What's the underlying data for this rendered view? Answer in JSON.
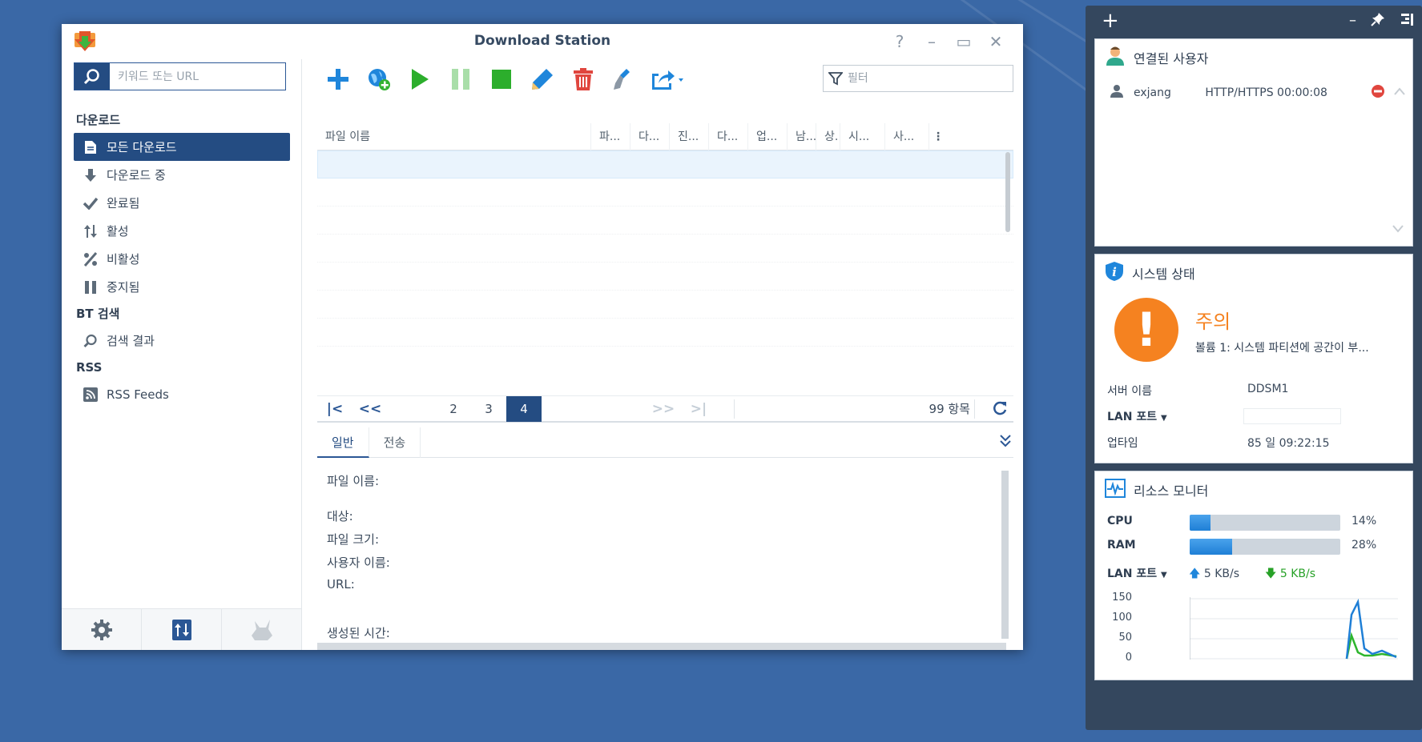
{
  "window": {
    "title": "Download Station",
    "controls": [
      "help-icon",
      "minimize-icon",
      "maximize-icon",
      "close-icon"
    ]
  },
  "search": {
    "placeholder": "키워드 또는 URL",
    "value": ""
  },
  "sidebar": {
    "download_section": "다운로드",
    "items": [
      {
        "label": "모든 다운로드",
        "icon": "document-icon",
        "selected": true
      },
      {
        "label": "다운로드 중",
        "icon": "arrow-down-icon"
      },
      {
        "label": "완료됨",
        "icon": "checkmark-icon"
      },
      {
        "label": "활성",
        "icon": "up-down-arrows-icon"
      },
      {
        "label": "비활성",
        "icon": "percent-icon"
      },
      {
        "label": "중지됨",
        "icon": "pause-icon"
      }
    ],
    "bt_section": "BT 검색",
    "bt_items": [
      {
        "label": "검색 결과",
        "icon": "magnifier-icon"
      }
    ],
    "rss_section": "RSS",
    "rss_items": [
      {
        "label": "RSS Feeds",
        "icon": "rss-icon"
      }
    ],
    "footer_buttons": [
      "settings-icon",
      "transfer-icon",
      "mascot-icon"
    ]
  },
  "toolbar": {
    "buttons": [
      "add-icon",
      "add-url-icon",
      "play-icon",
      "pause-icon",
      "stop-icon",
      "edit-icon",
      "delete-icon",
      "clear-icon",
      "share-icon"
    ],
    "filter_placeholder": "필터"
  },
  "table": {
    "columns": [
      "파일 이름",
      "파...",
      "다...",
      "진...",
      "다...",
      "업...",
      "남...",
      "상.",
      "시...",
      "사..."
    ],
    "rows": []
  },
  "pager": {
    "pages": [
      "2",
      "3",
      "4"
    ],
    "current_page": "4",
    "count_text": "99 항목"
  },
  "details": {
    "tabs": [
      "일반",
      "전송"
    ],
    "active_tab": "일반",
    "fields": {
      "filename": "파일 이름:",
      "destination": "대상:",
      "filesize": "파일 크기:",
      "username": "사용자 이름:",
      "url": "URL:",
      "created": "생성된 시간:"
    }
  },
  "widgets": {
    "connected_users": {
      "title": "연결된 사용자",
      "user": "exjang",
      "protocol": "HTTP/HTTPS",
      "duration": "00:00:08"
    },
    "system_status": {
      "title": "시스템 상태",
      "status": "주의",
      "message": "볼륨 1: 시스템 파티션에 공간이 부...",
      "server_label": "서버 이름",
      "server_value": "DDSM1",
      "lan_label": "LAN 포트",
      "uptime_label": "업타임",
      "uptime_value": "85 일 09:22:15"
    },
    "resource_monitor": {
      "title": "리소스 모니터",
      "cpu_label": "CPU",
      "cpu_pct": "14%",
      "cpu_fill": 0.14,
      "ram_label": "RAM",
      "ram_pct": "28%",
      "ram_fill": 0.28,
      "lan_label": "LAN 포트",
      "upload": "5 KB/s",
      "download": "5 KB/s",
      "chart_axis": [
        "150",
        "100",
        "50",
        "0"
      ],
      "colors": {
        "upload": "#1f7fd6",
        "download": "#2db52d"
      }
    }
  }
}
